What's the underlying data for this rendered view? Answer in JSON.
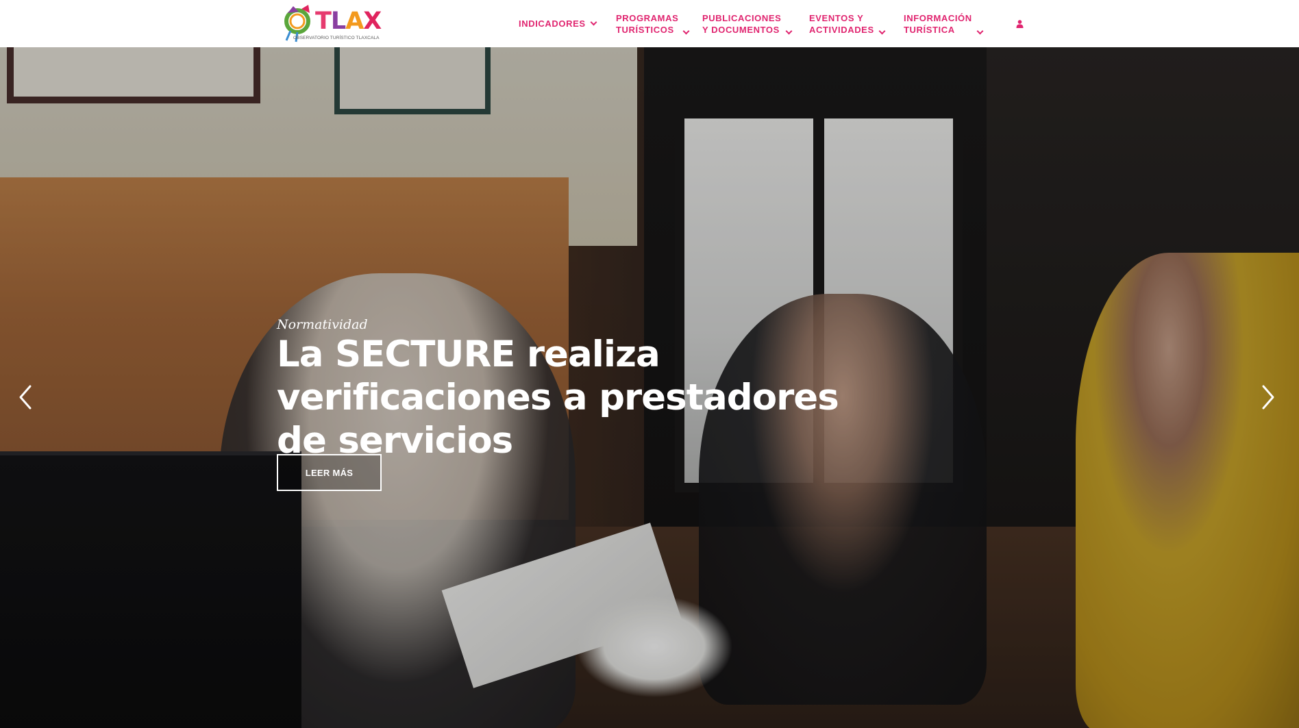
{
  "header": {
    "logo": {
      "wordmark": "OTLAX",
      "tagline": "OBSERVATORIO TURÍSTICO TLAXCALA",
      "colors": {
        "T": "#e63b6f",
        "L": "#8a3fa1",
        "A": "#f39a1e",
        "X": "#e0245e"
      }
    },
    "nav": [
      {
        "line1": "INDICADORES",
        "line2": "",
        "icon": "chevron-down-icon"
      },
      {
        "line1": "PROGRAMAS",
        "line2": "TURÍSTICOS",
        "icon": "chevron-down-icon"
      },
      {
        "line1": "PUBLICACIONES",
        "line2": "Y DOCUMENTOS",
        "icon": "chevron-down-icon"
      },
      {
        "line1": "EVENTOS Y",
        "line2": "ACTIVIDADES",
        "icon": "chevron-down-icon"
      },
      {
        "line1": "INFORMACIÓN",
        "line2": "TURÍSTICA",
        "icon": "chevron-down-icon"
      }
    ],
    "user_icon": "user-icon",
    "accent_color": "#e0246f"
  },
  "slider": {
    "category": "Normatividad",
    "headline": "La SECTURE realiza verificaciones a prestadores de servicios",
    "cta_label": "LEER MÁS",
    "prev_icon": "chevron-left-icon",
    "next_icon": "chevron-right-icon"
  }
}
